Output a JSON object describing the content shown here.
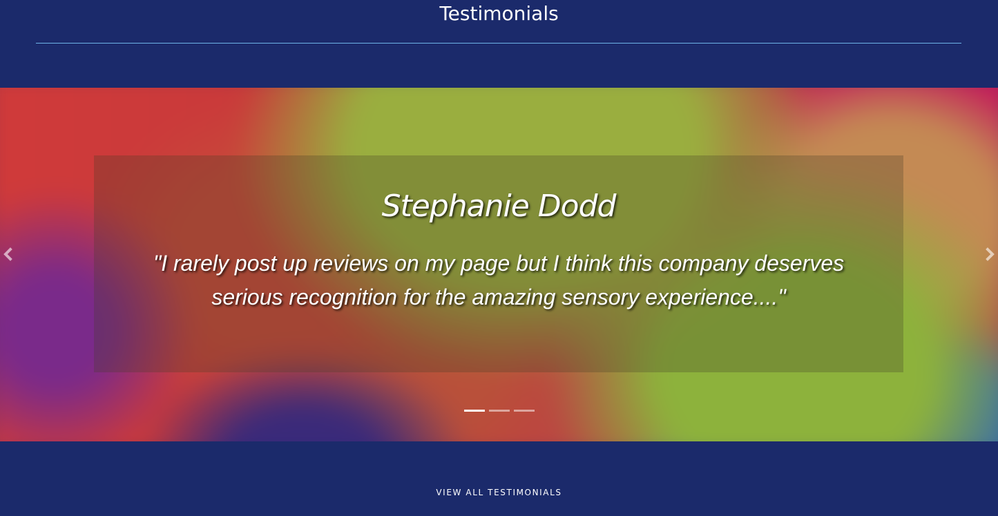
{
  "section": {
    "title": "Testimonials"
  },
  "carousel": {
    "author": "Stephanie Dodd",
    "quote": "\"I rarely post up reviews on my page but I think this company deserves serious recognition for the amazing sensory experience....\"",
    "prev_icon": "chevron-left-icon",
    "next_icon": "chevron-right-icon",
    "slide_count": 3,
    "active_slide": 1
  },
  "footer": {
    "view_all_label": "VIEW ALL TESTIMONIALS"
  },
  "colors": {
    "background": "#1b2a6b",
    "rule": "#6fb4e8",
    "text": "#ffffff"
  }
}
